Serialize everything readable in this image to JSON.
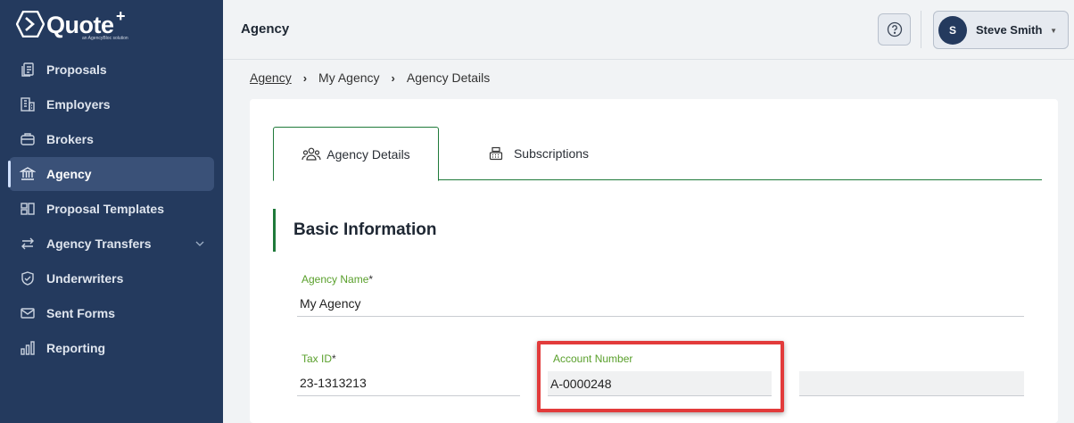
{
  "app": {
    "logo_text": "Quote",
    "logo_plus": "+",
    "logo_subtitle": "an AgencyBloc solution"
  },
  "sidebar": {
    "items": [
      {
        "label": "Proposals",
        "icon": "document-stack-icon"
      },
      {
        "label": "Employers",
        "icon": "building-icon"
      },
      {
        "label": "Brokers",
        "icon": "briefcase-icon"
      },
      {
        "label": "Agency",
        "icon": "bank-icon",
        "active": true
      },
      {
        "label": "Proposal Templates",
        "icon": "template-icon"
      },
      {
        "label": "Agency Transfers",
        "icon": "transfer-arrows-icon",
        "has_chevron": true
      },
      {
        "label": "Underwriters",
        "icon": "shield-check-icon"
      },
      {
        "label": "Sent Forms",
        "icon": "envelope-icon"
      },
      {
        "label": "Reporting",
        "icon": "bar-chart-icon"
      }
    ]
  },
  "header": {
    "title": "Agency",
    "help_icon": "question-circle-icon",
    "user": {
      "initial": "S",
      "name": "Steve Smith"
    }
  },
  "breadcrumb": {
    "items": [
      "Agency",
      "My Agency",
      "Agency Details"
    ]
  },
  "tabs": [
    {
      "label": "Agency Details",
      "icon": "users-group-icon",
      "active": true
    },
    {
      "label": "Subscriptions",
      "icon": "cash-register-icon",
      "active": false
    }
  ],
  "basic_info": {
    "section_title": "Basic Information",
    "agency_name": {
      "label": "Agency Name",
      "required_mark": "*",
      "value": "My Agency"
    },
    "tax_id": {
      "label": "Tax ID",
      "required_mark": "*",
      "value": "23-1313213"
    },
    "account_number": {
      "label": "Account Number",
      "value": "A-0000248"
    }
  },
  "colors": {
    "sidebar_bg": "#243a5e",
    "accent_green": "#1f7a3a",
    "label_green": "#5aa02c",
    "highlight_red": "#e23b3b"
  }
}
